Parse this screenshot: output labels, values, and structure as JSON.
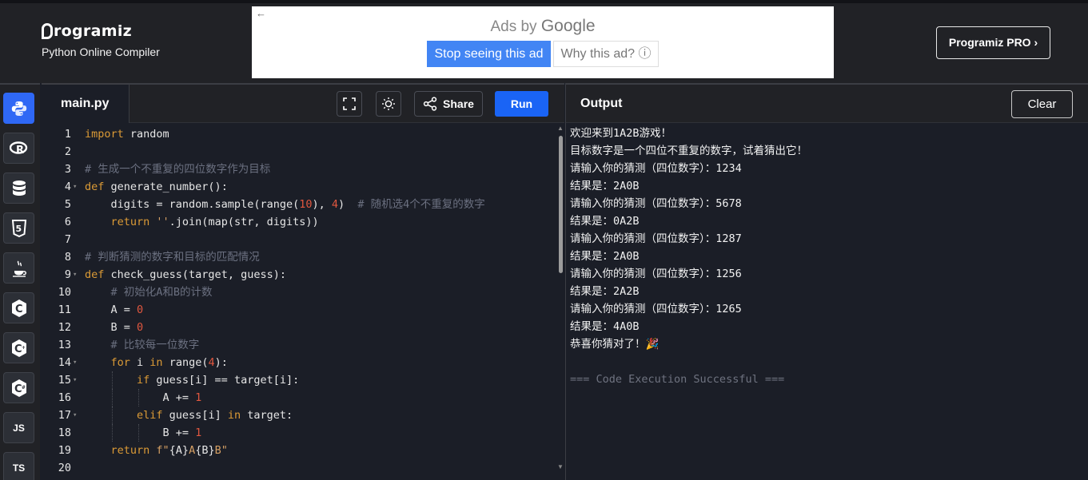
{
  "header": {
    "brand_name": "rogramiz",
    "brand_subtitle": "Python Online Compiler",
    "pro_label": "Programiz PRO ›"
  },
  "ad": {
    "title_prefix": "Ads by ",
    "title_brand": "Google",
    "stop_label": "Stop seeing this ad",
    "why_label": "Why this ad? ⓘ",
    "back_glyph": "←"
  },
  "sidebar": {
    "items": [
      {
        "icon": "python-icon",
        "label": ""
      },
      {
        "icon": "r-icon",
        "label": "R"
      },
      {
        "icon": "database-icon",
        "label": ""
      },
      {
        "icon": "html5-icon",
        "label": "5"
      },
      {
        "icon": "java-icon",
        "label": ""
      },
      {
        "icon": "c-icon",
        "label": "C"
      },
      {
        "icon": "cpp-icon",
        "label": "C"
      },
      {
        "icon": "csharp-icon",
        "label": "C"
      },
      {
        "icon": "js-icon",
        "label": "JS"
      },
      {
        "icon": "ts-icon",
        "label": "TS"
      }
    ]
  },
  "editor": {
    "tab_label": "main.py",
    "share_label": "Share",
    "run_label": "Run",
    "lines": [
      {
        "n": "1"
      },
      {
        "n": "2"
      },
      {
        "n": "3"
      },
      {
        "n": "4"
      },
      {
        "n": "5"
      },
      {
        "n": "6"
      },
      {
        "n": "7"
      },
      {
        "n": "8"
      },
      {
        "n": "9"
      },
      {
        "n": "10"
      },
      {
        "n": "11"
      },
      {
        "n": "12"
      },
      {
        "n": "13"
      },
      {
        "n": "14"
      },
      {
        "n": "15"
      },
      {
        "n": "16"
      },
      {
        "n": "17"
      },
      {
        "n": "18"
      },
      {
        "n": "19"
      },
      {
        "n": "20"
      }
    ],
    "code": {
      "l1_kw": "import",
      "l1_rest": " random",
      "l3": "# 生成一个不重复的四位数字作为目标",
      "l4_kw": "def",
      "l4_rest": " generate_number():",
      "l5_a": "    digits = random.sample(range(",
      "l5_n1": "10",
      "l5_b": "), ",
      "l5_n2": "4",
      "l5_c": ")  ",
      "l5_cm": "# 随机选4个不重复的数字",
      "l6_kw": "    return",
      "l6_str": " ''",
      "l6_rest": ".join(map(str, digits))",
      "l8": "# 判断猜测的数字和目标的匹配情况",
      "l9_kw": "def",
      "l9_rest": " check_guess(target, guess):",
      "l10": "    # 初始化A和B的计数",
      "l11_a": "    A = ",
      "l11_n": "0",
      "l12_a": "    B = ",
      "l12_n": "0",
      "l13": "    # 比较每一位数字",
      "l14_kw": "    for",
      "l14_a": " i ",
      "l14_kw2": "in",
      "l14_b": " range(",
      "l14_n": "4",
      "l14_c": "):",
      "l15_kw": "        if",
      "l15_rest": " guess[i] == target[i]:",
      "l16_a": "            A += ",
      "l16_n": "1",
      "l17_kw": "        elif",
      "l17_a": " guess[i] ",
      "l17_kw2": "in",
      "l17_b": " target:",
      "l18_a": "            B += ",
      "l18_n": "1",
      "l19_kw": "    return",
      "l19_f": " f\"",
      "l19_a": "{A}",
      "l19_s1": "A",
      "l19_b": "{B}",
      "l19_s2": "B\""
    }
  },
  "output": {
    "title": "Output",
    "clear_label": "Clear",
    "lines": [
      "欢迎来到1A2B游戏！",
      "目标数字是一个四位不重复的数字，试着猜出它！",
      "请输入你的猜测（四位数字）：1234",
      "结果是：2A0B",
      "请输入你的猜测（四位数字）：5678",
      "结果是：0A2B",
      "请输入你的猜测（四位数字）：1287",
      "结果是：2A0B",
      "请输入你的猜测（四位数字）：1256",
      "结果是：2A2B",
      "请输入你的猜测（四位数字）：1265",
      "结果是：4A0B",
      "恭喜你猜对了！🎉",
      "",
      "=== Code Execution Successful ==="
    ]
  },
  "colors": {
    "accent": "#1a64f5",
    "background": "#1b1e27",
    "header_bg": "#212226"
  }
}
